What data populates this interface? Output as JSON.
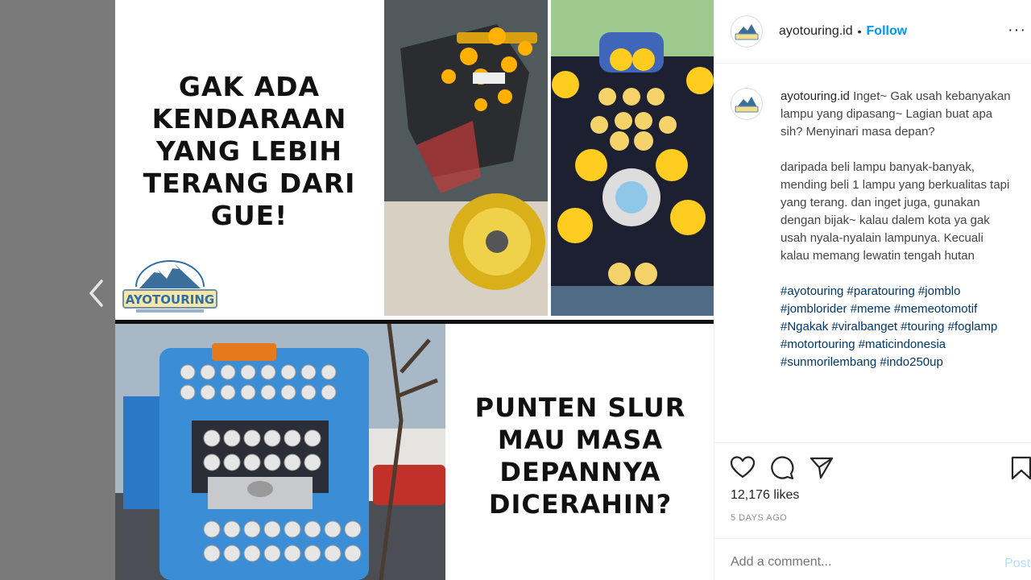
{
  "post": {
    "meme_top": "GAK ADA KENDARAAN YANG LEBIH TERANG DARI GUE!",
    "meme_bottom": "PUNTEN SLUR MAU MASA DEPANNYA DICERAHIN?",
    "logo_text": "AYOTOURING"
  },
  "header": {
    "username": "ayotouring.id",
    "separator": "•",
    "follow_label": "Follow",
    "more_label": "···"
  },
  "caption": {
    "username": "ayotouring.id",
    "line1": "Inget~ Gak usah kebanyakan lampu yang dipasang~ Lagian buat apa sih? Menyinari masa depan?",
    "line2": "daripada beli lampu banyak-banyak, mending beli 1 lampu yang berkualitas tapi yang terang. dan inget juga, gunakan dengan bijak~ kalau dalem kota ya gak usah nyala-nyalain lampunya. Kecuali kalau memang lewatin tengah hutan",
    "hashtags": "#ayotouring #paratouring #jomblo #jomblorider #meme #memeotomotif #Ngakak #viralbanget #touring #foglamp #motortouring #maticindonesia #sunmorilembang #indo250up"
  },
  "stats": {
    "likes": "12,176 likes",
    "ago": "5 DAYS AGO"
  },
  "comment": {
    "placeholder": "Add a comment...",
    "post_label": "Post"
  },
  "icons": [
    "chevron-left-icon",
    "heart-icon",
    "comment-icon",
    "share-icon",
    "bookmark-icon",
    "more-icon"
  ]
}
